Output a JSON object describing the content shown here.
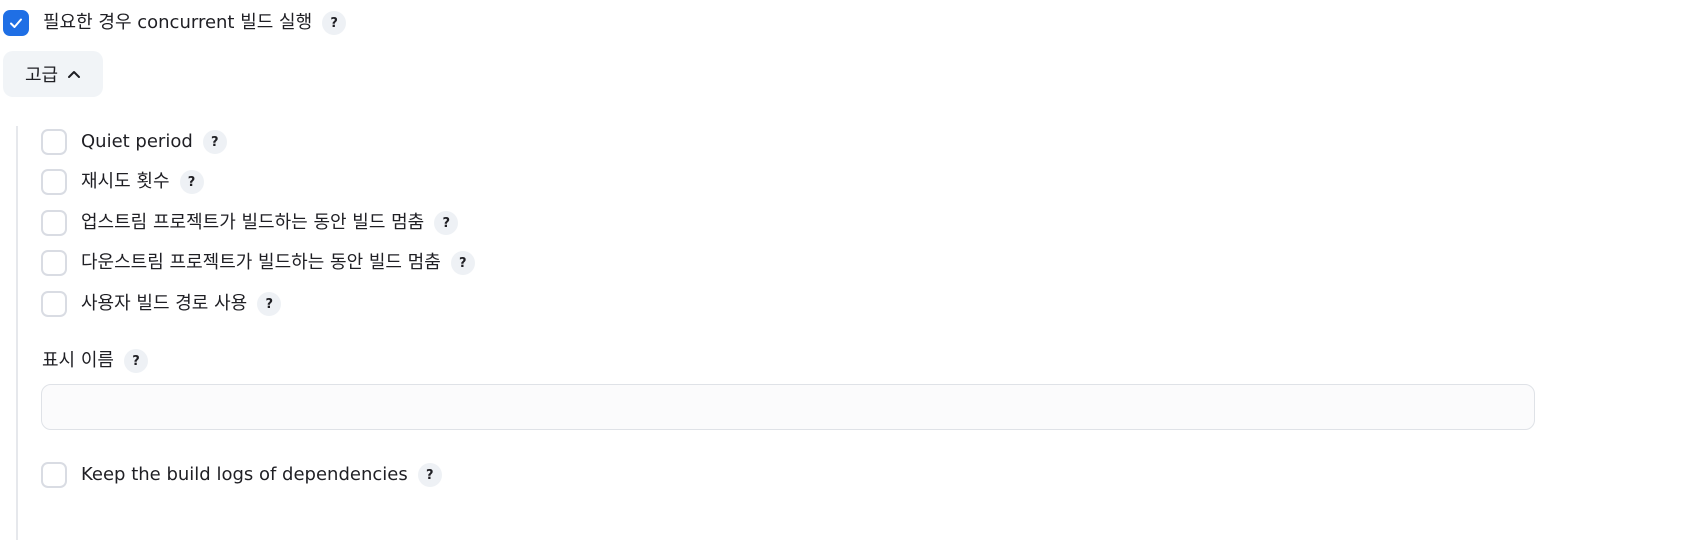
{
  "concurrent": {
    "label": "필요한 경우 concurrent 빌드 실행",
    "checked": true,
    "help": "?"
  },
  "advanced": {
    "label": "고급",
    "icon": "chevron-up-icon"
  },
  "options": [
    {
      "label": "Quiet period",
      "checked": false,
      "help": "?"
    },
    {
      "label": "재시도 횟수",
      "checked": false,
      "help": "?"
    },
    {
      "label": "업스트림 프로젝트가 빌드하는 동안 빌드 멈춤",
      "checked": false,
      "help": "?"
    },
    {
      "label": "다운스트림 프로젝트가 빌드하는 동안 빌드 멈춤",
      "checked": false,
      "help": "?"
    },
    {
      "label": "사용자 빌드 경로 사용",
      "checked": false,
      "help": "?"
    }
  ],
  "display_name": {
    "label": "표시 이름",
    "help": "?",
    "value": "",
    "placeholder": ""
  },
  "keep_logs": {
    "label": "Keep the build logs of dependencies",
    "checked": false,
    "help": "?"
  },
  "colors": {
    "accent": "#1f6fe5",
    "border": "#d9dce3",
    "help_bg": "#eef1f5",
    "button_bg": "#f1f4f7"
  }
}
